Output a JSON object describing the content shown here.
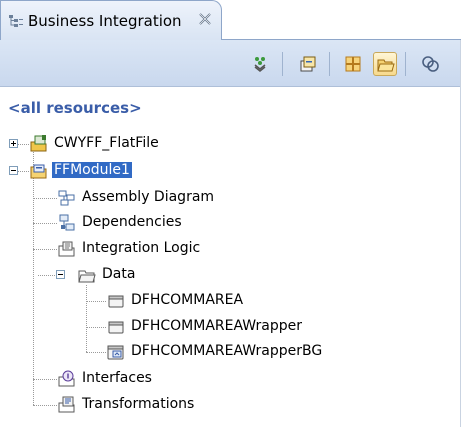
{
  "view": {
    "tab_title": "Business Integration",
    "tab_icon": "business-integration-view-icon",
    "close_icon": "close-icon"
  },
  "toolbar": {
    "buttons": [
      {
        "icon": "show-categories-icon",
        "active": false
      },
      {
        "icon": "collapse-all-icon",
        "active": false
      },
      {
        "icon": "filter-icon",
        "active": false
      },
      {
        "icon": "open-folder-icon",
        "active": true
      },
      {
        "icon": "link-editor-icon",
        "active": false
      }
    ]
  },
  "scope_link": "<all resources>",
  "tree": {
    "items": [
      {
        "label": "CWYFF_FlatFile",
        "icon": "library-icon",
        "expanded": false
      },
      {
        "label": "FFModule1",
        "icon": "module-icon",
        "expanded": true,
        "selected": true,
        "children": [
          {
            "label": "Assembly Diagram",
            "icon": "assembly-diagram-icon"
          },
          {
            "label": "Dependencies",
            "icon": "dependencies-icon"
          },
          {
            "label": "Integration Logic",
            "icon": "integration-logic-icon"
          },
          {
            "label": "Data",
            "icon": "data-folder-icon",
            "expanded": true,
            "children": [
              {
                "label": "DFHCOMMAREA",
                "icon": "business-object-icon"
              },
              {
                "label": "DFHCOMMAREAWrapper",
                "icon": "business-object-icon"
              },
              {
                "label": "DFHCOMMAREAWrapperBG",
                "icon": "business-graph-icon"
              }
            ]
          },
          {
            "label": "Interfaces",
            "icon": "interfaces-icon"
          },
          {
            "label": "Transformations",
            "icon": "transformations-icon"
          }
        ]
      }
    ]
  },
  "colors": {
    "selection": "#316ac5",
    "link": "#3a5da8",
    "toolbar": "#c9d8ee"
  }
}
